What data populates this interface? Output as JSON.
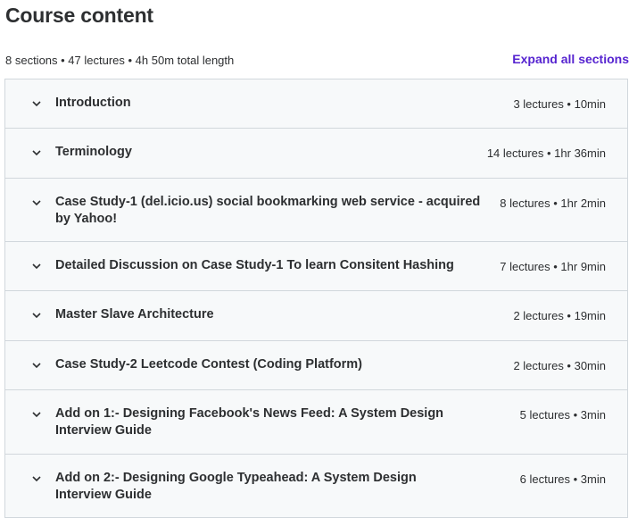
{
  "header": {
    "title": "Course content",
    "summary": "8 sections • 47 lectures • 4h 50m total length",
    "expand_label": "Expand all sections"
  },
  "colors": {
    "accent": "#5624d0",
    "section_bg": "#f7f9fa",
    "border": "#d1d7dc",
    "text": "#2d2f31"
  },
  "sections": [
    {
      "title": "Introduction",
      "info": "3 lectures • 10min"
    },
    {
      "title": "Terminology",
      "info": "14 lectures • 1hr 36min"
    },
    {
      "title": "Case Study-1 (del.icio.us) social bookmarking web service - acquired by Yahoo!",
      "info": "8 lectures • 1hr 2min"
    },
    {
      "title": "Detailed Discussion on Case Study-1 To learn Consitent Hashing",
      "info": "7 lectures • 1hr 9min"
    },
    {
      "title": "Master Slave Architecture",
      "info": "2 lectures • 19min"
    },
    {
      "title": "Case Study-2 Leetcode Contest (Coding Platform)",
      "info": "2 lectures • 30min"
    },
    {
      "title": "Add on 1:- Designing Facebook's News Feed: A System Design Interview Guide",
      "info": "5 lectures • 3min"
    },
    {
      "title": "Add on 2:- Designing Google Typeahead: A System Design Interview Guide",
      "info": "6 lectures • 3min"
    }
  ]
}
